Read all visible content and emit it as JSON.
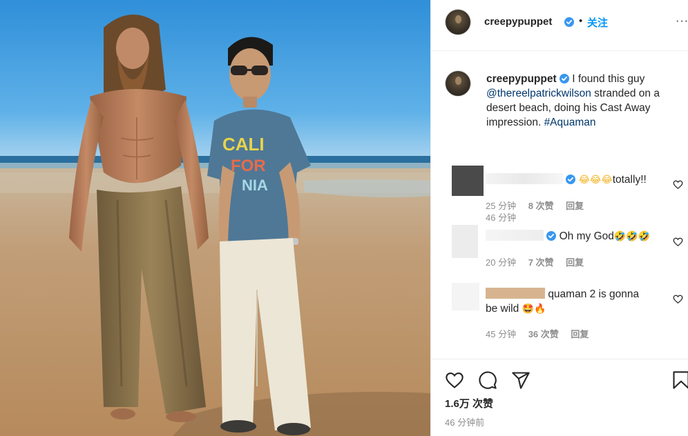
{
  "colors": {
    "accent_blue": "#0095f6",
    "verified_blue": "#3897f0",
    "text_primary": "#262626",
    "text_secondary": "#8e8e8e",
    "link": "#00376b"
  },
  "photo": {
    "shirt_text_line1": "CALI",
    "shirt_text_line2": "FOR",
    "shirt_text_line3": "NIA"
  },
  "header": {
    "username": "creepypuppet",
    "separator": "•",
    "follow_label": "关注",
    "more_label": "···"
  },
  "caption": {
    "username": "creepypuppet",
    "text_before_mention": "I found this guy",
    "mention": "@thereelpatrickwilson",
    "text_after_mention": "stranded on a desert beach, doing his Cast Away impression.",
    "hashtag": "#Aquaman",
    "time": "46 分钟"
  },
  "comments": [
    {
      "text": "totally!!",
      "emoji": "😂😂😂",
      "time": "25 分钟",
      "likes": "8 次赞",
      "reply": "回复"
    },
    {
      "text": "Oh my God",
      "emoji": "🤣🤣🤣",
      "time": "20 分钟",
      "likes": "7 次赞",
      "reply": "回复"
    },
    {
      "text": "quaman 2 is gonna be wild",
      "emoji": "🤩🔥",
      "time": "45 分钟",
      "likes": "36 次赞",
      "reply": "回复"
    }
  ],
  "footer": {
    "likes_total": "1.6万 次赞",
    "post_time": "46 分钟前"
  },
  "icons": [
    "heart-icon",
    "comment-icon",
    "share-icon",
    "bookmark-icon",
    "verified-badge-icon",
    "more-options-icon"
  ]
}
